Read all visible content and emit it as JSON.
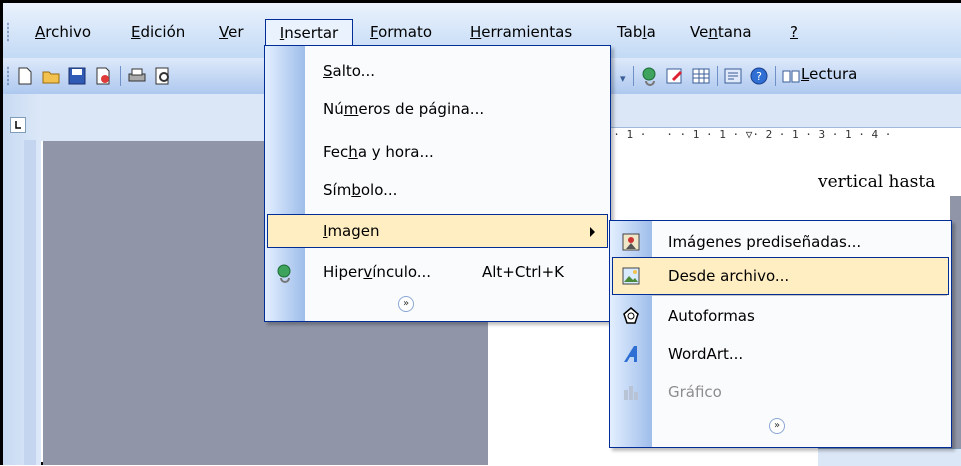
{
  "menubar": {
    "items": [
      {
        "pre": "",
        "u": "A",
        "post": "rchivo"
      },
      {
        "pre": "",
        "u": "E",
        "post": "dición"
      },
      {
        "pre": "",
        "u": "V",
        "post": "er"
      },
      {
        "pre": "",
        "u": "I",
        "post": "nsertar"
      },
      {
        "pre": "",
        "u": "F",
        "post": "ormato"
      },
      {
        "pre": "",
        "u": "H",
        "post": "erramientas"
      },
      {
        "pre": "Tab",
        "u": "l",
        "post": "a"
      },
      {
        "pre": "Ve",
        "u": "n",
        "post": "tana"
      },
      {
        "pre": "",
        "u": "?",
        "post": ""
      }
    ]
  },
  "toolbar": {
    "reading": {
      "pre": "",
      "u": "L",
      "post": "ectura"
    }
  },
  "ruler": {
    "text": "1 · 1 ·   · · 1 · 1 · ▽· 2 · 1 · 3 · 1 · 4 ·"
  },
  "document": {
    "text": "vertical hasta"
  },
  "insert_menu": {
    "items": [
      {
        "pre": "",
        "u": "S",
        "post": "alto..."
      },
      {
        "pre": "Nú",
        "u": "m",
        "post": "eros de página..."
      },
      {
        "pre": "Fec",
        "u": "h",
        "post": "a y hora..."
      },
      {
        "pre": "Sím",
        "u": "b",
        "post": "olo..."
      },
      {
        "pre": "",
        "u": "I",
        "post": "magen"
      },
      {
        "pre": "Hiper",
        "u": "v",
        "post": "ínculo..."
      }
    ],
    "hyperlink_shortcut": "Alt+Ctrl+K",
    "expand_glyph": "»"
  },
  "image_submenu": {
    "items": [
      {
        "pre": "",
        "u": "I",
        "post": "mágenes prediseñadas..."
      },
      {
        "pre": "",
        "u": "D",
        "post": "esde archivo..."
      },
      {
        "pre": "",
        "u": "A",
        "post": "utoformas"
      },
      {
        "pre": "",
        "u": "W",
        "post": "ordArt..."
      },
      {
        "pre": "",
        "u": "G",
        "post": "ráfico"
      }
    ],
    "expand_glyph": "»"
  },
  "colors": {
    "highlight": "#ffeec2",
    "menu_border": "#002d96"
  }
}
